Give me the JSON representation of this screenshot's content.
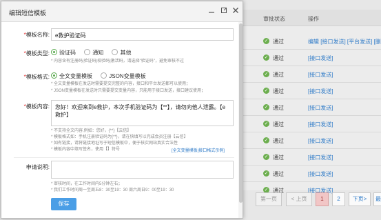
{
  "dialog": {
    "title": "编辑短信模板",
    "icons": {
      "min": "minimize-icon",
      "max": "maximize-icon",
      "close": "close-icon"
    }
  },
  "form": {
    "name_label": "模板名称:",
    "name_value": "e救护验证码",
    "type_label": "模板类型:",
    "type_options": [
      "验证码",
      "通知",
      "其他"
    ],
    "type_selected": "验证码",
    "type_hint": "* 内容含有注册码|验证码|校验码|激活码，请选择\"验证码\"，避免审核不过",
    "format_label": "模板格式:",
    "format_options": [
      "全文变量模板",
      "JSON变量模板"
    ],
    "format_selected": "全文变量模板",
    "format_hint1": "* 全文变量模板在发送时需要提交完整的内容，接口和平台发送都可以使用；",
    "format_hint2": "* JSON变量模板在发送时只需要提交变量内容，只能用于接口发送，接口建议使用；",
    "content_label": "模板内容:",
    "content_value": "您好！欢迎来到e救护，本次手机验证码为【**】，请勿向他人泄露。【e救护】",
    "content_hints": [
      "* 不支持全文内容,例如：您好，{**}【云信】",
      "* 模板格式如：手机注册验证码为{**}，请在快填写以完成会员注册【云信】",
      "* 如有链接，请将链接地址写于短信模板中，便于核实网站真实合法性",
      "* 模板内容中填写签名，使用【】符号"
    ],
    "help_link": "[全文变量模板|接口格式示例]",
    "apply_label": "申请说明:",
    "apply_value": "",
    "apply_hints": [
      "* 审核时间，在工作时间内5分钟左右；",
      "* 我们工作时间周一至周五8：30至19：30 周六周日9：00至19：30"
    ],
    "save_label": "保存"
  },
  "background": {
    "col_status": "审批状态",
    "col_action": "操作",
    "rows": [
      {
        "status": "通过",
        "action": "编辑 [接口发送] [平台发送] [删"
      },
      {
        "status": "通过",
        "action": "[接口发送]"
      },
      {
        "status": "通过",
        "action": "[接口发送]"
      },
      {
        "status": "通过",
        "action": "[接口发送]"
      },
      {
        "status": "通过",
        "action": "[接口发送]"
      },
      {
        "status": "通过",
        "action": "[接口发送]"
      },
      {
        "status": "通过",
        "action": "[接口发送]"
      },
      {
        "status": "通过",
        "action": "[接口发送]"
      },
      {
        "status": "通过",
        "action": "[接口发送]"
      },
      {
        "status": "通过",
        "action": "[接口发送]"
      }
    ],
    "pager": {
      "first": "第一页",
      "prev": "< 上页",
      "p1": "1",
      "p2": "2",
      "next": "下页>",
      "last": "最"
    }
  },
  "colors": {
    "accent": "#4a9ee6",
    "ok": "#6cae4e",
    "link": "#2f7bc8",
    "required": "#e02020"
  }
}
